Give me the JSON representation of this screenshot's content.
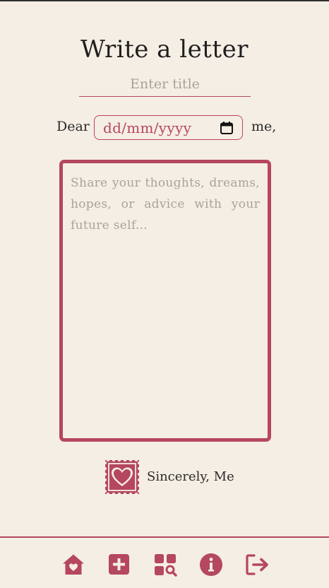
{
  "page": {
    "title": "Write a letter",
    "title_placeholder": "Enter title"
  },
  "salutation": {
    "dear": "Dear",
    "date_placeholder": "dd/mm/yyyy",
    "me": "me,"
  },
  "letter": {
    "placeholder": "Share your thoughts, dreams, hopes, or advice with your future self..."
  },
  "signature": {
    "text": "Sincerely, Me",
    "stamp_icon": "heart-stamp-icon"
  },
  "nav": {
    "items": [
      {
        "icon": "home-heart-icon",
        "label": "Home"
      },
      {
        "icon": "plus-square-icon",
        "label": "New letter"
      },
      {
        "icon": "grid-search-icon",
        "label": "Browse letters"
      },
      {
        "icon": "info-circle-icon",
        "label": "Info"
      },
      {
        "icon": "logout-icon",
        "label": "Log out"
      }
    ]
  },
  "colors": {
    "accent": "#b5475f",
    "background": "#f5eee4",
    "text": "#2b2b2b"
  }
}
